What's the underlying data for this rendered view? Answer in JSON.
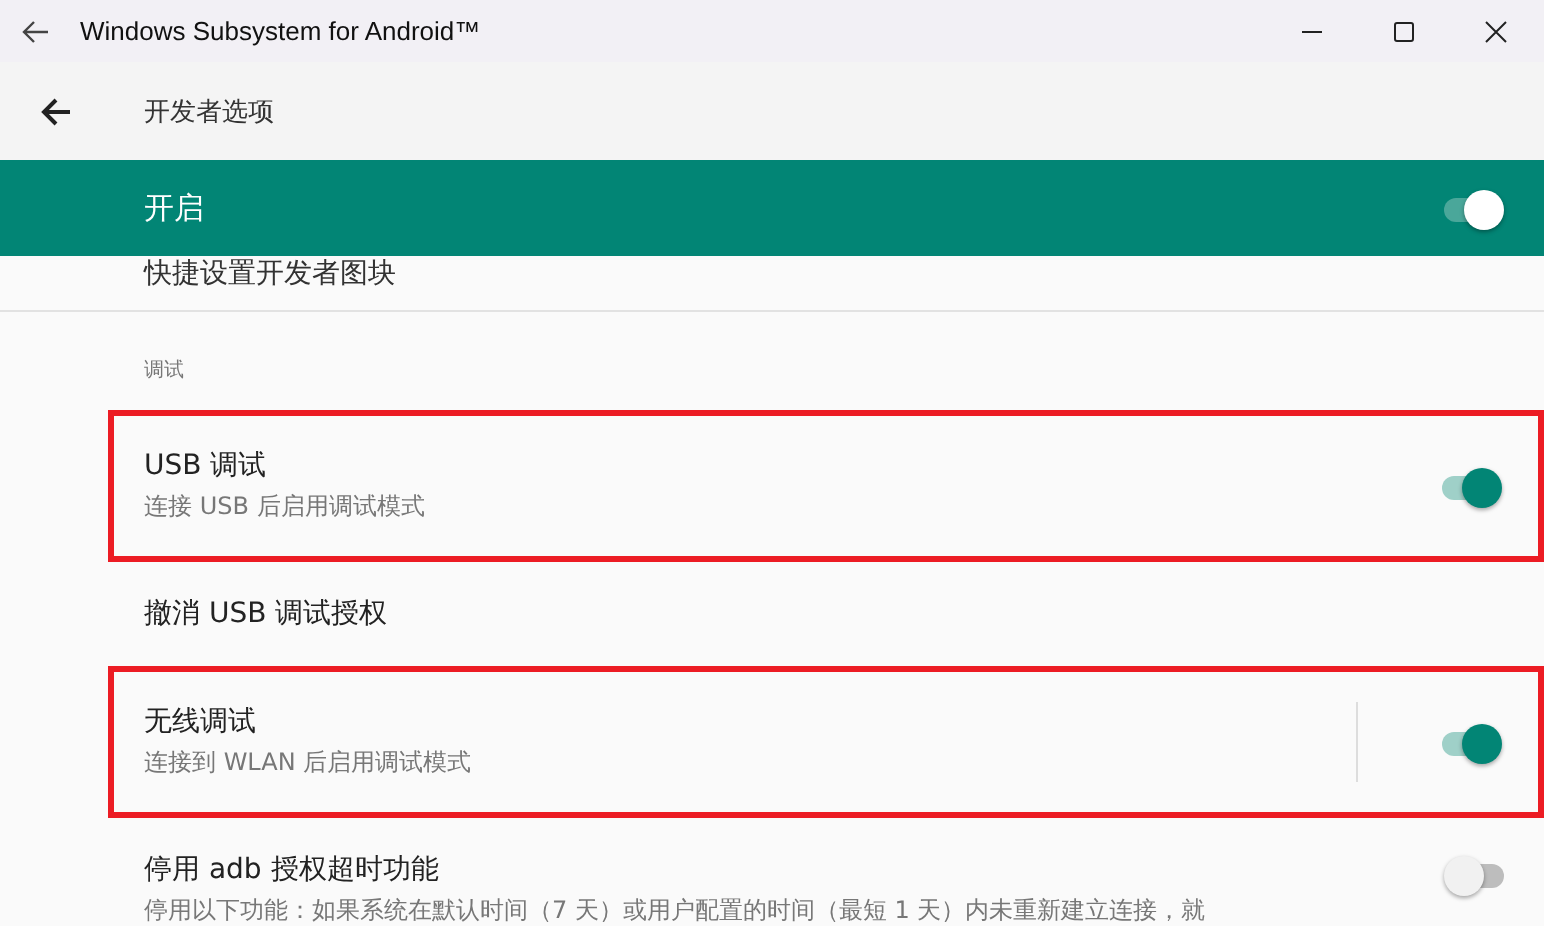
{
  "window": {
    "title": "Windows Subsystem for Android™"
  },
  "header": {
    "title": "开发者选项"
  },
  "master_switch": {
    "label": "开启",
    "on": true
  },
  "partial_item": {
    "title": "快捷设置开发者图块"
  },
  "category": {
    "title": "调试"
  },
  "items": [
    {
      "kind": "switch",
      "title": "USB 调试",
      "summary": "连接 USB 后启用调试模式",
      "on": true,
      "highlighted": true,
      "divider": false
    },
    {
      "kind": "plain",
      "title": "撤消 USB 调试授权",
      "highlighted": false
    },
    {
      "kind": "switch",
      "title": "无线调试",
      "summary": "连接到 WLAN 后启用调试模式",
      "on": true,
      "highlighted": true,
      "divider": true
    },
    {
      "kind": "switch",
      "title": "停用 adb 授权超时功能",
      "summary": "停用以下功能：如果系统在默认时间（7 天）或用户配置的时间（最短 1 天）内未重新建立连接，就",
      "on": false,
      "highlighted": false,
      "divider": false
    }
  ]
}
